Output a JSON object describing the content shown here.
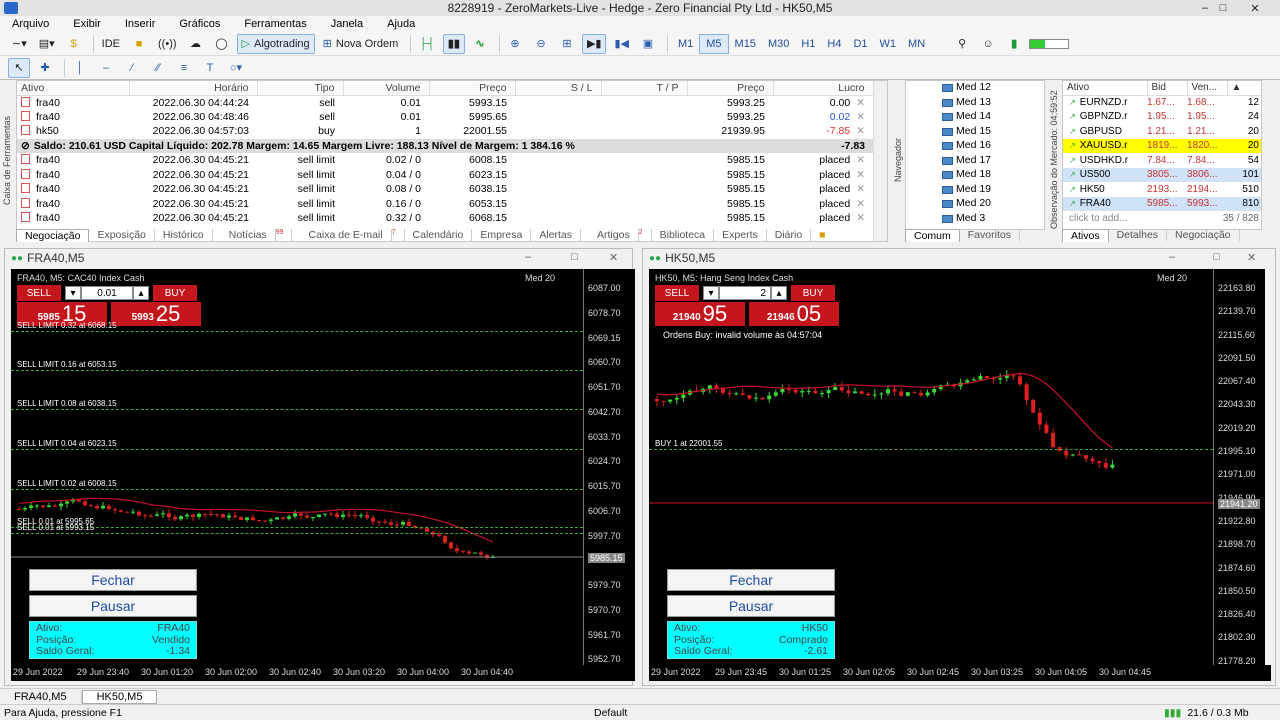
{
  "window": {
    "title": "8228919 - ZeroMarkets-Live - Hedge - Zero Financial Pty Ltd - HK50,M5"
  },
  "menu": [
    "Arquivo",
    "Exibir",
    "Inserir",
    "Gráficos",
    "Ferramentas",
    "Janela",
    "Ajuda"
  ],
  "toolbar": {
    "ide": "IDE",
    "algotrading": "Algotrading",
    "nova_ordem": "Nova Ordem",
    "timeframes": [
      "M1",
      "M5",
      "M15",
      "M30",
      "H1",
      "H4",
      "D1",
      "W1",
      "MN"
    ],
    "active_tf": "M5"
  },
  "trade": {
    "headers": [
      "Ativo",
      "Horário",
      "Tipo",
      "Volume",
      "Preço",
      "S / L",
      "T / P",
      "Preço",
      "Lucro"
    ],
    "positions": [
      {
        "ativo": "fra40",
        "hora": "2022.06.30 04:44:24",
        "tipo": "sell",
        "vol": "0.01",
        "preco": "5993.15",
        "sl": "",
        "tp": "",
        "atual": "5993.25",
        "lucro": "0.00",
        "cls": ""
      },
      {
        "ativo": "fra40",
        "hora": "2022.06.30 04:48:46",
        "tipo": "sell",
        "vol": "0.01",
        "preco": "5995.65",
        "sl": "",
        "tp": "",
        "atual": "5993.25",
        "lucro": "0.02",
        "cls": "blue"
      },
      {
        "ativo": "hk50",
        "hora": "2022.06.30 04:57:03",
        "tipo": "buy",
        "vol": "1",
        "preco": "22001.55",
        "sl": "",
        "tp": "",
        "atual": "21939.95",
        "lucro": "-7.85",
        "cls": "red"
      }
    ],
    "summary_text": "Saldo: 210.61 USD  Capital Líquido: 202.78  Margem: 14.65  Margem Livre: 188.13  Nível de Margem: 1 384.16 %",
    "summary_profit": "-7.83",
    "orders": [
      {
        "ativo": "fra40",
        "hora": "2022.06.30 04:45:21",
        "tipo": "sell limit",
        "vol": "0.02 / 0",
        "preco": "6008.15",
        "atual": "5985.15",
        "status": "placed"
      },
      {
        "ativo": "fra40",
        "hora": "2022.06.30 04:45:21",
        "tipo": "sell limit",
        "vol": "0.04 / 0",
        "preco": "6023.15",
        "atual": "5985.15",
        "status": "placed"
      },
      {
        "ativo": "fra40",
        "hora": "2022.06.30 04:45:21",
        "tipo": "sell limit",
        "vol": "0.08 / 0",
        "preco": "6038.15",
        "atual": "5985.15",
        "status": "placed"
      },
      {
        "ativo": "fra40",
        "hora": "2022.06.30 04:45:21",
        "tipo": "sell limit",
        "vol": "0.16 / 0",
        "preco": "6053.15",
        "atual": "5985.15",
        "status": "placed"
      },
      {
        "ativo": "fra40",
        "hora": "2022.06.30 04:45:21",
        "tipo": "sell limit",
        "vol": "0.32 / 0",
        "preco": "6068.15",
        "atual": "5985.15",
        "status": "placed"
      }
    ],
    "tabs": [
      "Negociação",
      "Exposição",
      "Histórico",
      "Notícias",
      "Caixa de E-mail",
      "Calendário",
      "Empresa",
      "Alertas",
      "Artigos",
      "Biblioteca",
      "Experts",
      "Diário"
    ],
    "tab_badges": {
      "noticias": "99",
      "email": "7",
      "artigos": "2"
    },
    "side_label": "Caixa de Ferramentas"
  },
  "navigator": {
    "items": [
      "Med 12",
      "Med 13",
      "Med 14",
      "Med 15",
      "Med 16",
      "Med 17",
      "Med 18",
      "Med 19",
      "Med 20",
      "Med 3"
    ],
    "tabs": [
      "Comum",
      "Favoritos"
    ],
    "side_label": "Navegador"
  },
  "market_watch": {
    "headers": [
      "Ativo",
      "Bid",
      "Ven...",
      ""
    ],
    "rows": [
      {
        "s": "EURNZD.r",
        "bid": "1.67...",
        "ask": "1.68...",
        "n": "12",
        "c": ""
      },
      {
        "s": "GBPNZD.r",
        "bid": "1.95...",
        "ask": "1.95...",
        "n": "24",
        "c": ""
      },
      {
        "s": "GBPUSD",
        "bid": "1.21...",
        "ask": "1.21...",
        "n": "20",
        "c": ""
      },
      {
        "s": "XAUUSD.r",
        "bid": "1819...",
        "ask": "1820...",
        "n": "20",
        "c": "y"
      },
      {
        "s": "USDHKD.r",
        "bid": "7.84...",
        "ask": "7.84...",
        "n": "54",
        "c": ""
      },
      {
        "s": "US500",
        "bid": "3805...",
        "ask": "3806...",
        "n": "101",
        "c": "b"
      },
      {
        "s": "HK50",
        "bid": "2193...",
        "ask": "2194...",
        "n": "510",
        "c": ""
      },
      {
        "s": "FRA40",
        "bid": "5985...",
        "ask": "5993...",
        "n": "810",
        "c": "b"
      }
    ],
    "add": "click to add...",
    "count": "35 / 828",
    "tabs": [
      "Ativos",
      "Detalhes",
      "Negociação"
    ],
    "side_label": "Observação do Mercado: 04:59:52"
  },
  "chart1": {
    "title": "FRA40,M5",
    "subtitle": "FRA40, M5:  CAC40 Index Cash",
    "badge": "Med 20",
    "sell_label": "SELL",
    "buy_label": "BUY",
    "volume": "0.01",
    "bid_small": "5985",
    "bid_big": "15",
    "ask_small": "5993",
    "ask_big": "25",
    "yticks": [
      "6087.00",
      "6078.70",
      "6069.15",
      "6060.70",
      "6051.70",
      "6042.70",
      "6033.70",
      "6024.70",
      "6015.70",
      "6006.70",
      "5997.70",
      "5988.70",
      "5979.70",
      "5970.70",
      "5961.70",
      "5952.70"
    ],
    "xticks": [
      "29 Jun 2022",
      "29 Jun 23:40",
      "30 Jun 01:20",
      "30 Jun 02:00",
      "30 Jun 02:40",
      "30 Jun 03:20",
      "30 Jun 04:00",
      "30 Jun 04:40"
    ],
    "price_tag": "5985.15",
    "levels": [
      "SELL LIMIT 0.32 at 6068.15",
      "SELL LIMIT 0.16 at 6053.15",
      "SELL LIMIT 0.08 at 6038.15",
      "SELL LIMIT 0.04 at 6023.15",
      "SELL LIMIT 0.02 at 6008.15",
      "SELL 0.01 at 5995.65",
      "SELL 0.01 at 5993.15"
    ],
    "fechar": "Fechar",
    "pausar": "Pausar",
    "info": [
      [
        "Ativo:",
        "FRA40"
      ],
      [
        "Posição:",
        "Vendido"
      ],
      [
        "Saldo Geral:",
        "-1.34"
      ]
    ]
  },
  "chart2": {
    "title": "HK50,M5",
    "subtitle": "HK50, M5:  Hang Seng Index Cash",
    "badge": "Med 20",
    "sell_label": "SELL",
    "buy_label": "BUY",
    "volume": "2",
    "bid_small": "21940",
    "bid_big": "95",
    "ask_small": "21946",
    "ask_big": "05",
    "warning": "Ordens Buy:  invalid volume   às  04:57:04",
    "yticks": [
      "22163.80",
      "22139.70",
      "22115.60",
      "22091.50",
      "22067.40",
      "22043.30",
      "22019.20",
      "21995.10",
      "21971.00",
      "21946.90",
      "21922.80",
      "21898.70",
      "21874.60",
      "21850.50",
      "21826.40",
      "21802.30",
      "21778.20"
    ],
    "xticks": [
      "29 Jun 2022",
      "29 Jun 23:45",
      "30 Jun 01:25",
      "30 Jun 02:05",
      "30 Jun 02:45",
      "30 Jun 03:25",
      "30 Jun 04:05",
      "30 Jun 04:45"
    ],
    "price_tag": "21941.20",
    "levels": [
      "BUY 1 at 22001.55"
    ],
    "fechar": "Fechar",
    "pausar": "Pausar",
    "info": [
      [
        "Ativo:",
        "HK50"
      ],
      [
        "Posição:",
        "Comprado"
      ],
      [
        "Saldo Geral:",
        "-2.61"
      ]
    ]
  },
  "bottom_tabs": [
    "FRA40,M5",
    "HK50,M5"
  ],
  "status": {
    "help": "Para Ajuda, pressione F1",
    "profile": "Default",
    "traffic": "21.6 / 0.3 Mb"
  }
}
